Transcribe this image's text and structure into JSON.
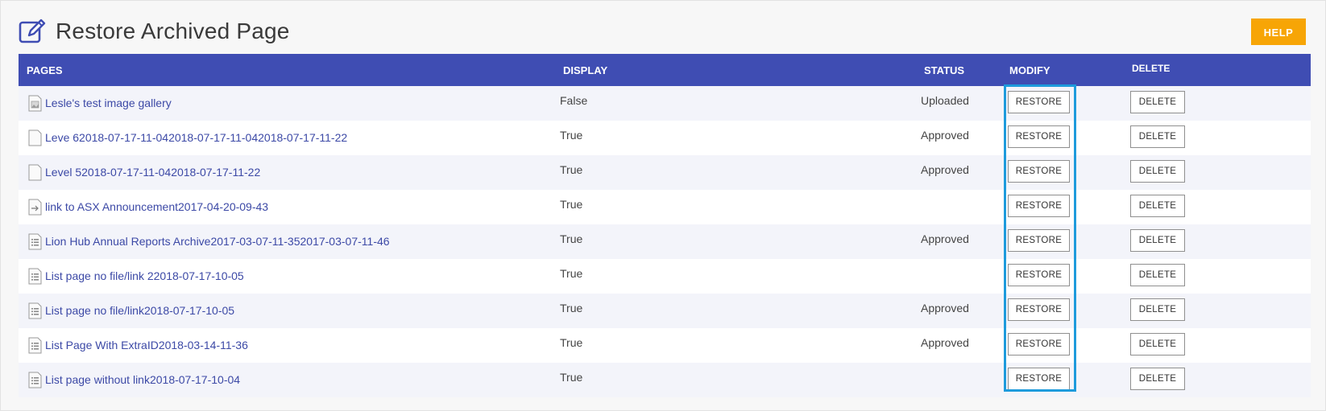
{
  "page": {
    "title": "Restore Archived Page",
    "help_label": "HELP"
  },
  "table": {
    "headers": {
      "pages": "PAGES",
      "display": "DISPLAY",
      "status": "STATUS",
      "modify": "MODIFY",
      "delete": "DELETE"
    },
    "rows": [
      {
        "name": "Lesle's test image gallery",
        "icon": "image-page-icon",
        "display": "False",
        "status": "Uploaded",
        "restore_label": "RESTORE",
        "delete_label": "DELETE"
      },
      {
        "name": "Leve 62018-07-17-11-042018-07-17-11-042018-07-17-11-22",
        "icon": "blank-page-icon",
        "display": "True",
        "status": "Approved",
        "restore_label": "RESTORE",
        "delete_label": "DELETE"
      },
      {
        "name": "Level 52018-07-17-11-042018-07-17-11-22",
        "icon": "blank-page-icon",
        "display": "True",
        "status": "Approved",
        "restore_label": "RESTORE",
        "delete_label": "DELETE"
      },
      {
        "name": "link to ASX Announcement2017-04-20-09-43",
        "icon": "link-page-icon",
        "display": "True",
        "status": "",
        "restore_label": "RESTORE",
        "delete_label": "DELETE"
      },
      {
        "name": "Lion Hub Annual Reports Archive2017-03-07-11-352017-03-07-11-46",
        "icon": "list-page-icon",
        "display": "True",
        "status": "Approved",
        "restore_label": "RESTORE",
        "delete_label": "DELETE"
      },
      {
        "name": "List page no file/link 22018-07-17-10-05",
        "icon": "list-page-icon",
        "display": "True",
        "status": "",
        "restore_label": "RESTORE",
        "delete_label": "DELETE"
      },
      {
        "name": "List page no file/link2018-07-17-10-05",
        "icon": "list-page-icon",
        "display": "True",
        "status": "Approved",
        "restore_label": "RESTORE",
        "delete_label": "DELETE"
      },
      {
        "name": "List Page With ExtraID2018-03-14-11-36",
        "icon": "list-page-icon",
        "display": "True",
        "status": "Approved",
        "restore_label": "RESTORE",
        "delete_label": "DELETE"
      },
      {
        "name": "List page without link2018-07-17-10-04",
        "icon": "list-page-icon",
        "display": "True",
        "status": "",
        "restore_label": "RESTORE",
        "delete_label": "DELETE"
      }
    ]
  },
  "colors": {
    "header_bg": "#3f4db3",
    "help_bg": "#f7a506",
    "link": "#3c49a6",
    "highlight": "#1e9bdc"
  }
}
